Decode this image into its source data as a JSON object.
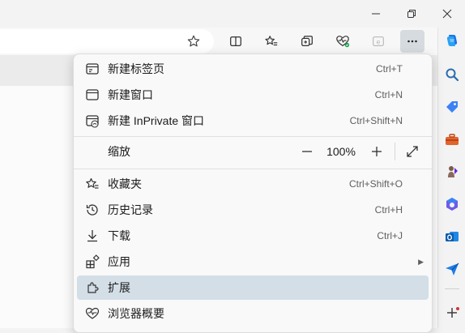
{
  "menu": {
    "items": [
      {
        "label": "新建标签页",
        "shortcut": "Ctrl+T",
        "icon": "new-tab-icon"
      },
      {
        "label": "新建窗口",
        "shortcut": "Ctrl+N",
        "icon": "new-window-icon"
      },
      {
        "label": "新建 InPrivate 窗口",
        "shortcut": "Ctrl+Shift+N",
        "icon": "inprivate-window-icon"
      }
    ],
    "zoom": {
      "label": "缩放",
      "minus": "—",
      "value": "100%",
      "plus": "+"
    },
    "items2": [
      {
        "label": "收藏夹",
        "shortcut": "Ctrl+Shift+O",
        "icon": "favorites-icon"
      },
      {
        "label": "历史记录",
        "shortcut": "Ctrl+H",
        "icon": "history-icon"
      },
      {
        "label": "下载",
        "shortcut": "Ctrl+J",
        "icon": "download-icon"
      },
      {
        "label": "应用",
        "shortcut": "",
        "icon": "apps-icon",
        "arrow": "▶"
      },
      {
        "label": "扩展",
        "shortcut": "",
        "icon": "extensions-icon"
      },
      {
        "label": "浏览器概要",
        "shortcut": "",
        "icon": "browser-essentials-icon"
      }
    ]
  },
  "colors": {
    "highlight": "#d3dee7",
    "copilot": "#1a73e8",
    "notification_dot": "#d13438"
  }
}
